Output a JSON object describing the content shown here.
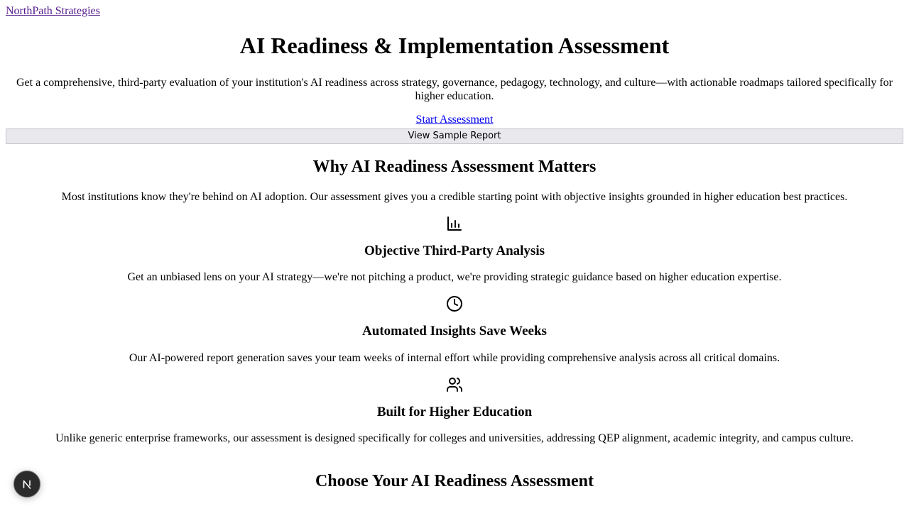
{
  "header": {
    "brand": "NorthPath Strategies"
  },
  "hero": {
    "title": "AI Readiness & Implementation Assessment",
    "subtitle": "Get a comprehensive, third-party evaluation of your institution's AI readiness across strategy, governance, pedagogy, technology, and culture—with actionable roadmaps tailored specifically for higher education.",
    "primary_cta": "Start Assessment",
    "secondary_cta": "View Sample Report"
  },
  "why": {
    "heading": "Why AI Readiness Assessment Matters",
    "intro": "Most institutions know they're behind on AI adoption. Our assessment gives you a credible starting point with objective insights grounded in higher education best practices.",
    "features": [
      {
        "icon": "bar-chart-icon",
        "title": "Objective Third-Party Analysis",
        "text": "Get an unbiased lens on your AI strategy—we're not pitching a product, we're providing strategic guidance based on higher education expertise."
      },
      {
        "icon": "clock-icon",
        "title": "Automated Insights Save Weeks",
        "text": "Our AI-powered report generation saves your team weeks of internal effort while providing comprehensive analysis across all critical domains."
      },
      {
        "icon": "users-icon",
        "title": "Built for Higher Education",
        "text": "Unlike generic enterprise frameworks, our assessment is designed specifically for colleges and universities, addressing QEP alignment, academic integrity, and campus culture."
      }
    ]
  },
  "choose": {
    "heading": "Choose Your AI Readiness Assessment"
  },
  "floating_badge": {
    "icon": "nextjs-n-icon"
  }
}
